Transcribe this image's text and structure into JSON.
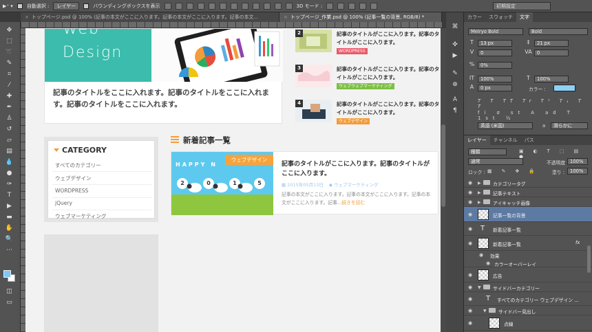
{
  "options_bar": {
    "auto_select_label": "自動選択 :",
    "auto_select_value": "レイヤー",
    "bounding_box_label": "バウンディングボックスを表示",
    "mode_3d_label": "3D モード :",
    "workspace_value": "初期設定"
  },
  "tabs": [
    {
      "close": "×",
      "label": "トップページ.psd @ 100% (記事の本文がここに入ります。記事の本文がここに入ります。記事の本文..."
    },
    {
      "close": "×",
      "label": "トップページ_作業.psd @ 100% (記事一覧の背景, RGB/8) *"
    }
  ],
  "canvas": {
    "hero": {
      "word1": "Web",
      "word2": "Design",
      "title": "記事のタイトルをここに入れます。記事のタイトルをここに入れます。記事のタイトルをここに入れます。"
    },
    "side_articles": [
      {
        "num": "2",
        "title": "記事のタイトルがここに入ります。記事のタイトルがここに入ります。",
        "tag": "WORDPRESS",
        "tag_color": "#e95a6b"
      },
      {
        "num": "3",
        "title": "記事のタイトルがここに入ります。記事のタイトルがここに入ります。",
        "tag": "ウェブウェブマーケティング",
        "tag_color": "#7cc043"
      },
      {
        "num": "4",
        "title": "記事のタイトルがここに入ります。記事のタイトルがここに入ります。",
        "tag": "ウェブデザイン",
        "tag_color": "#f39c3a"
      }
    ],
    "category": {
      "heading": "CATEGORY",
      "links": [
        "すべてのカテゴリー",
        "ウェブデザイン",
        "WORDPRESS",
        "jQuery",
        "ウェブマーケティング"
      ]
    },
    "news": {
      "heading": "新着記事一覧",
      "ribbon": "ウェブデザイン",
      "happy": "HAPPY N",
      "balls": [
        "2",
        "0",
        "1",
        "5"
      ],
      "title": "記事のタイトルがここに入ります。記事のタイトルがここに入ります。",
      "date": "2015年05月13日",
      "category": "ウェブマーケティング",
      "body": "記事の本文がここに入ります。記事の本文がここに入ります。記事の本文がここに入ります。記事...",
      "more": "続きを読む"
    }
  },
  "props_panel": {
    "tabs": [
      "カラー",
      "スウォッチ",
      "文字"
    ],
    "font_family": "Meiryo Bold",
    "font_style": "Bold",
    "font_size": "13 px",
    "leading": "21 px",
    "tracking_a": "0",
    "tracking_b": "0",
    "kerning_pct": "0%",
    "scale_v": "100%",
    "scale_h": "100%",
    "baseline": "0 px",
    "color_label": "カラー :",
    "color_value": "#8fd0f5",
    "language": "英語 (米国)",
    "antialias": "滑らかに",
    "aa_label": "a"
  },
  "layers_panel": {
    "tabs": [
      "レイヤー",
      "チャンネル",
      "パス"
    ],
    "filter": "種類",
    "blend_mode": "通常",
    "opacity_label": "不透明度 :",
    "opacity": "100%",
    "lock_label": "ロック :",
    "fill_label": "塗り :",
    "fill": "100%",
    "layers": [
      {
        "name": "カテゴリータグ",
        "kind": "group"
      },
      {
        "name": "記事テキスト",
        "kind": "group"
      },
      {
        "name": "アイキャッチ画像",
        "kind": "group"
      },
      {
        "name": "記事一覧の背景",
        "kind": "pixel",
        "selected": true
      },
      {
        "name": "新着記事一覧",
        "kind": "text"
      },
      {
        "name": "新着記事一覧",
        "kind": "pixel",
        "fx": "fx"
      },
      {
        "name": "効果",
        "kind": "effect"
      },
      {
        "name": "カラーオーバーレイ",
        "kind": "effect"
      },
      {
        "name": "広告",
        "kind": "pixel"
      },
      {
        "name": "サイドバーカテゴリー",
        "kind": "group-open"
      },
      {
        "name": "すべてのカテゴリー ウェブデザイン ...",
        "kind": "text"
      },
      {
        "name": "サイドバー見出し",
        "kind": "group-open"
      },
      {
        "name": "点線",
        "kind": "pixel"
      }
    ]
  },
  "tools": [
    "move-tool",
    "marquee-tool",
    "lasso-tool",
    "quick-select-tool",
    "crop-tool",
    "eyedropper-tool",
    "spot-heal-tool",
    "brush-tool",
    "stamp-tool",
    "history-brush-tool",
    "eraser-tool",
    "gradient-tool",
    "blur-tool",
    "dodge-tool",
    "pen-tool",
    "type-tool",
    "path-select-tool",
    "shape-tool",
    "hand-tool",
    "zoom-tool"
  ]
}
